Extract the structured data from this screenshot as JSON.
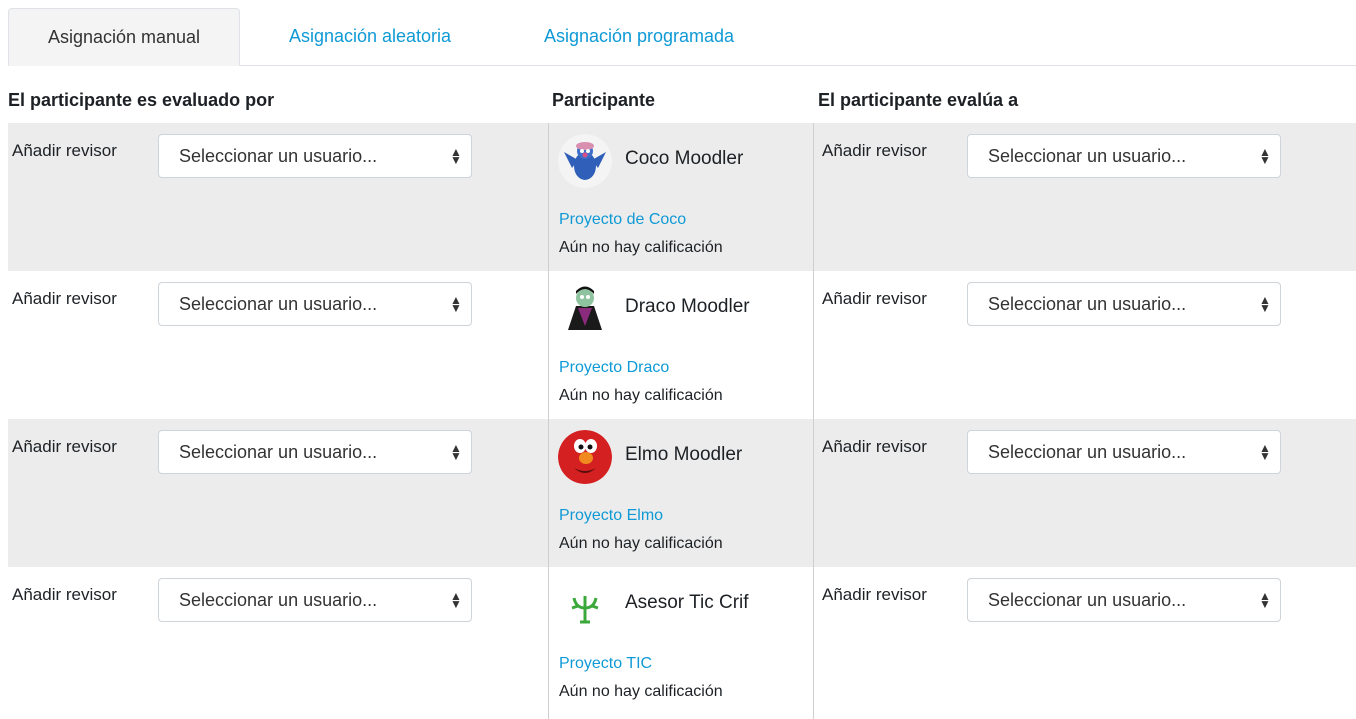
{
  "tabs": [
    {
      "label": "Asignación manual",
      "active": true
    },
    {
      "label": "Asignación aleatoria",
      "active": false
    },
    {
      "label": "Asignación programada",
      "active": false
    }
  ],
  "headers": {
    "reviewed_by": "El participante es evaluado por",
    "participant": "Participante",
    "reviews": "El participante evalúa a"
  },
  "colors": {
    "link": "#0f9ad6",
    "shaded_row": "#ececec"
  },
  "rows": [
    {
      "add_label_left": "Añadir revisor",
      "select_left": "Seleccionar un usuario...",
      "name": "Coco Moodler",
      "avatar_icon": "grover-avatar-icon",
      "submission": "Proyecto de Coco",
      "grade_status": "Aún no hay calificación",
      "add_label_right": "Añadir revisor",
      "select_right": "Seleccionar un usuario..."
    },
    {
      "add_label_left": "Añadir revisor",
      "select_left": "Seleccionar un usuario...",
      "name": "Draco Moodler",
      "avatar_icon": "count-avatar-icon",
      "submission": "Proyecto Draco",
      "grade_status": "Aún no hay calificación",
      "add_label_right": "Añadir revisor",
      "select_right": "Seleccionar un usuario..."
    },
    {
      "add_label_left": "Añadir revisor",
      "select_left": "Seleccionar un usuario...",
      "name": "Elmo Moodler",
      "avatar_icon": "elmo-avatar-icon",
      "submission": "Proyecto Elmo",
      "grade_status": "Aún no hay calificación",
      "add_label_right": "Añadir revisor",
      "select_right": "Seleccionar un usuario..."
    },
    {
      "add_label_left": "Añadir revisor",
      "select_left": "Seleccionar un usuario...",
      "name": "Asesor Tic Crif",
      "avatar_icon": "plant-logo-icon",
      "submission": "Proyecto TIC",
      "grade_status": "Aún no hay calificación",
      "add_label_right": "Añadir revisor",
      "select_right": "Seleccionar un usuario..."
    }
  ]
}
